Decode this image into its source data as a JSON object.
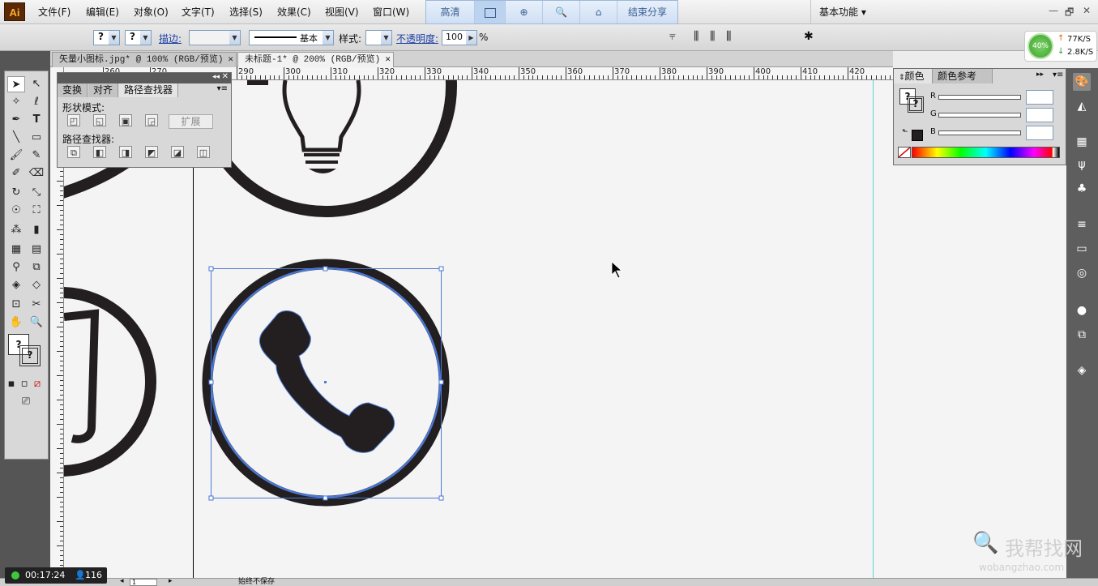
{
  "app": {
    "logo": "Ai"
  },
  "menu": [
    "文件(F)",
    "编辑(E)",
    "对象(O)",
    "文字(T)",
    "选择(S)",
    "效果(C)",
    "视图(V)",
    "窗口(W)"
  ],
  "share_bar": {
    "quality": "高清",
    "end_share": "结束分享"
  },
  "workspace": {
    "label": "基本功能 ▾"
  },
  "window_controls": {
    "minimize": "—",
    "restore": "🗗",
    "close": "✕"
  },
  "control_bar": {
    "stroke_label": "描边:",
    "line_style": "基本",
    "style_label": "样式:",
    "opacity_label": "不透明度:",
    "opacity_value": "100",
    "opacity_unit": "%"
  },
  "perf_widget": {
    "percent": "40%",
    "upload": "77K/S",
    "download": "2.8K/S"
  },
  "doc_tabs": [
    {
      "label": "矢量小图标.jpg* @ 100% (RGB/预览)",
      "close": "✕"
    },
    {
      "label": "未标题-1* @ 200% (RGB/预览)",
      "close": "✕"
    }
  ],
  "ruler": {
    "labels": [
      "260",
      "270",
      "290",
      "300",
      "310",
      "320",
      "330",
      "340",
      "350",
      "360",
      "370",
      "380",
      "390",
      "400",
      "410",
      "420"
    ]
  },
  "pathfinder_panel": {
    "tabs": [
      "变换",
      "对齐",
      "路径查找器"
    ],
    "shape_modes_label": "形状模式:",
    "expand_label": "扩展",
    "pathfinders_label": "路径查找器:"
  },
  "color_panel": {
    "tabs": [
      "颜色",
      "颜色参考"
    ],
    "channels": [
      "R",
      "G",
      "B"
    ]
  },
  "recording": {
    "time": "00:17:24",
    "viewers": "116"
  },
  "status": {
    "page": "1",
    "info": "始终不保存"
  },
  "watermark": {
    "brand": "我帮找网",
    "url": "wobangzhao.com"
  }
}
